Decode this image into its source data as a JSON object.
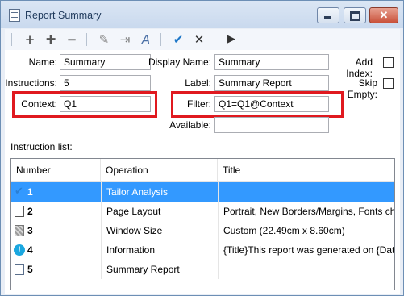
{
  "window": {
    "title": "Report Summary"
  },
  "title_buttons": {
    "close_glyph": "✕"
  },
  "toolbar": {
    "add": "+",
    "add_child": "✚",
    "remove": "−",
    "edit": "✎",
    "move": "⇥",
    "spell": "A",
    "accept": "✔",
    "cancel": "✕",
    "run": "▶"
  },
  "form": {
    "name_label": "Name:",
    "name_value": "Summary",
    "display_name_label": "Display Name:",
    "display_name_value": "Summary",
    "add_index_label": "Add Index:",
    "instructions_label": "Instructions:",
    "instructions_value": "5",
    "label_label": "Label:",
    "label_value": "Summary Report",
    "skip_empty_label": "Skip Empty:",
    "context_label": "Context:",
    "context_value": "Q1",
    "filter_label": "Filter:",
    "filter_value": "Q1=Q1@Context",
    "available_label": "Available:",
    "available_value": "",
    "highlight_color": "#e0191f"
  },
  "instruction_list": {
    "label": "Instruction list:",
    "columns": [
      "Number",
      "Operation",
      "Title"
    ],
    "rows": [
      {
        "number": "1",
        "operation": "Tailor Analysis",
        "title": "",
        "icon": "check-icon",
        "selected": true
      },
      {
        "number": "2",
        "operation": "Page Layout",
        "title": "Portrait, New Borders/Margins, Fonts ch...",
        "icon": "page-icon",
        "selected": false
      },
      {
        "number": "3",
        "operation": "Window Size",
        "title": "Custom (22.49cm x 8.60cm)",
        "icon": "window-icon",
        "selected": false
      },
      {
        "number": "4",
        "operation": "Information",
        "title": "{Title}This report was generated on {Dat...",
        "icon": "info-icon",
        "selected": false
      },
      {
        "number": "5",
        "operation": "Summary Report",
        "title": "",
        "icon": "report-icon",
        "selected": false
      }
    ],
    "selection_color": "#3399ff"
  }
}
